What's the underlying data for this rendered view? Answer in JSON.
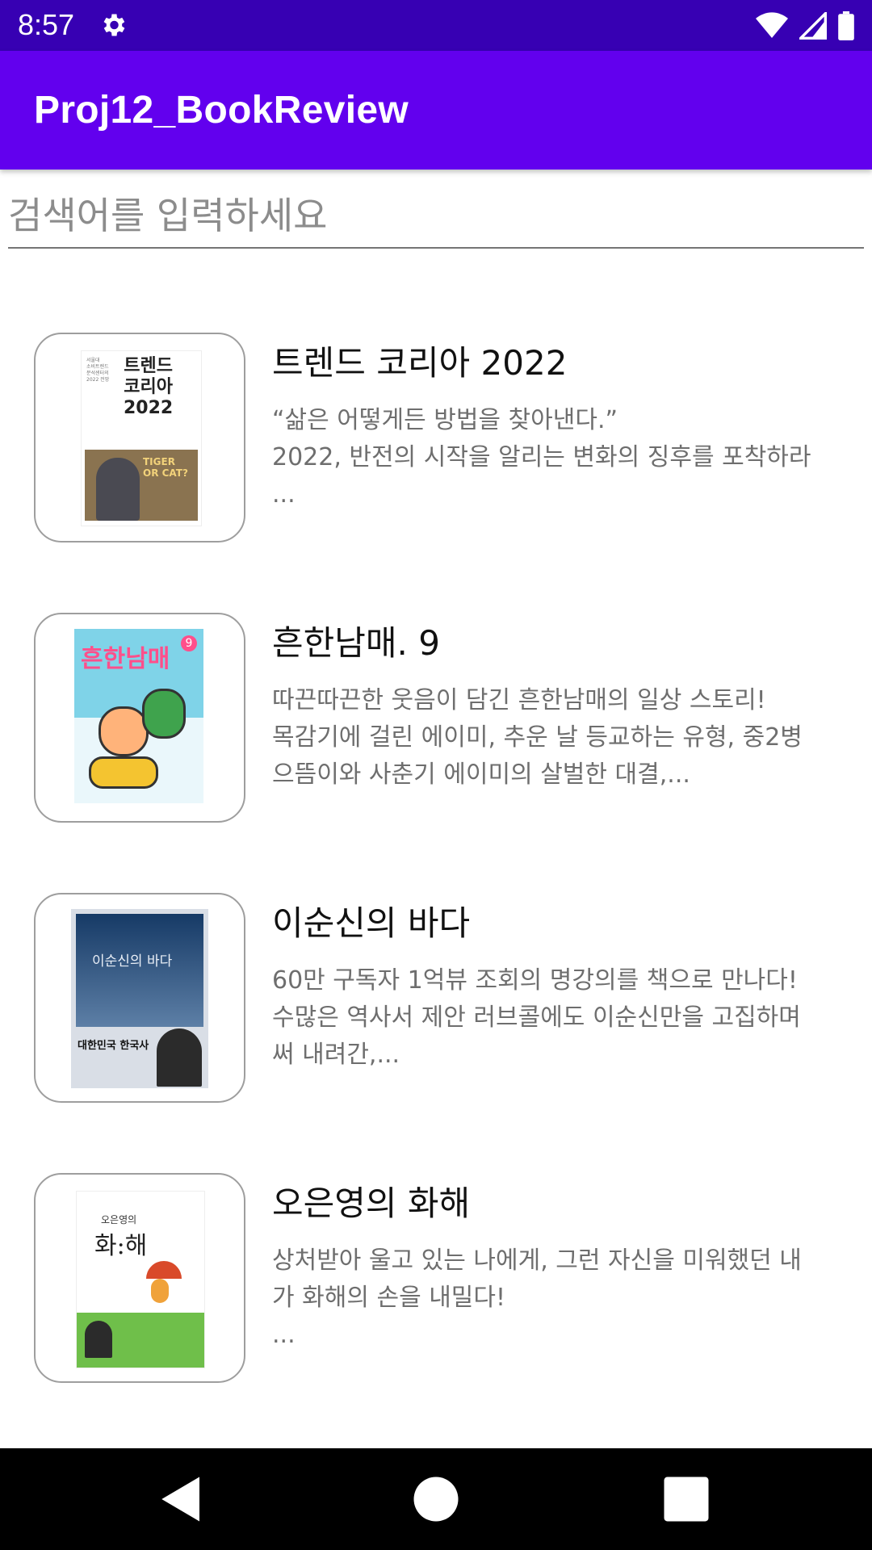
{
  "status_bar": {
    "time": "8:57",
    "icons": [
      "gear-icon",
      "wifi-icon",
      "cellular-signal-icon",
      "battery-icon"
    ],
    "background": "#3700B3"
  },
  "app_bar": {
    "title": "Proj12_BookReview",
    "background": "#6200EE"
  },
  "search": {
    "placeholder": "검색어를 입력하세요",
    "value": ""
  },
  "books": [
    {
      "title": "트렌드 코리아 2022",
      "description": "“삶은 어떻게든 방법을 찾아낸다.”\n2022, 반전의 시작을 알리는 변화의 징후를 포착하라\n...",
      "cover": {
        "title": "트렌드\n코리아\n2022",
        "small_text": "서울대\n소비트렌드\n분석센터의\n2022 전망",
        "badge": "TIGER\nOR CAT?",
        "colors": [
          "#ffffff",
          "#8a7350",
          "#c9a24a"
        ]
      }
    },
    {
      "title": "흔한남매. 9",
      "description": "따끈따끈한 웃음이 담긴 흔한남매의 일상 스토리!\n목감기에 걸린 에이미, 추운 날 등교하는 유형, 중2병\n으뜸이와 사춘기 에이미의 살벌한 대결,...",
      "cover": {
        "title": "흔한남매",
        "number": "9",
        "colors": [
          "#7fd3e8",
          "#ff4f8b",
          "#f4c430"
        ]
      }
    },
    {
      "title": "이순신의 바다",
      "description": "60만 구독자 1억뷰 조회의 명강의를 책으로 만나다!\n수많은 역사서 제안 러브콜에도 이순신만을 고집하며\n써 내려간,...",
      "cover": {
        "title": "이순신의 바다",
        "footer": "대한민국 한국사",
        "colors": [
          "#163a66",
          "#d9dee6",
          "#111111"
        ]
      }
    },
    {
      "title": "오은영의 화해",
      "description": "상처받아 울고 있는 나에게, 그런 자신을 미워했던 내\n가 화해의 손을 내밀다!\n...",
      "cover": {
        "title": "화:해",
        "author": "오은영의",
        "colors": [
          "#ffffff",
          "#6fbf4a",
          "#d94a2a"
        ]
      }
    }
  ],
  "nav_bar": {
    "icons": [
      "back-icon",
      "home-icon",
      "recents-icon"
    ]
  }
}
